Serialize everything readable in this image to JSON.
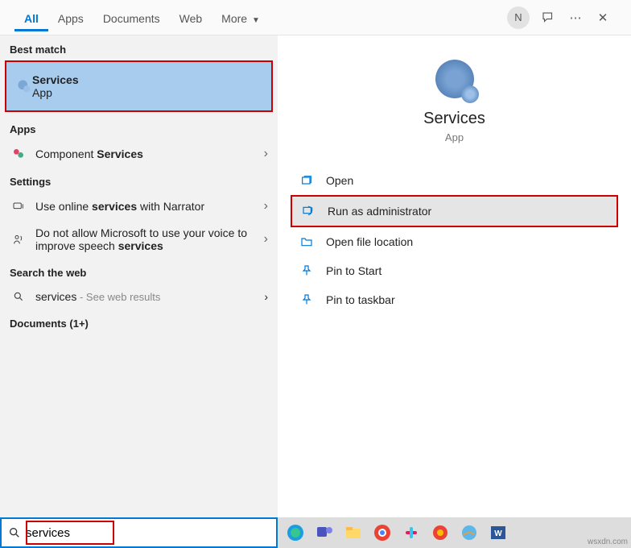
{
  "tabs": {
    "all": "All",
    "apps": "Apps",
    "documents": "Documents",
    "web": "Web",
    "more": "More"
  },
  "avatar_initial": "N",
  "groups": {
    "best_match": "Best match",
    "apps": "Apps",
    "settings": "Settings",
    "search_web": "Search the web",
    "documents": "Documents (1+)"
  },
  "best": {
    "title": "Services",
    "sub": "App"
  },
  "app_result_prefix": "Component ",
  "app_result_bold": "Services",
  "setting1_prefix": "Use online ",
  "setting1_bold": "services",
  "setting1_suffix": " with Narrator",
  "setting2_prefix": "Do not allow Microsoft to use your voice to improve speech ",
  "setting2_bold": "services",
  "web_term": "services",
  "web_suffix": " - See web results",
  "detail": {
    "title": "Services",
    "sub": "App"
  },
  "actions": {
    "open": "Open",
    "run_admin": "Run as administrator",
    "open_loc": "Open file location",
    "pin_start": "Pin to Start",
    "pin_taskbar": "Pin to taskbar"
  },
  "search_value": "services",
  "watermark": "wsxdn.com"
}
